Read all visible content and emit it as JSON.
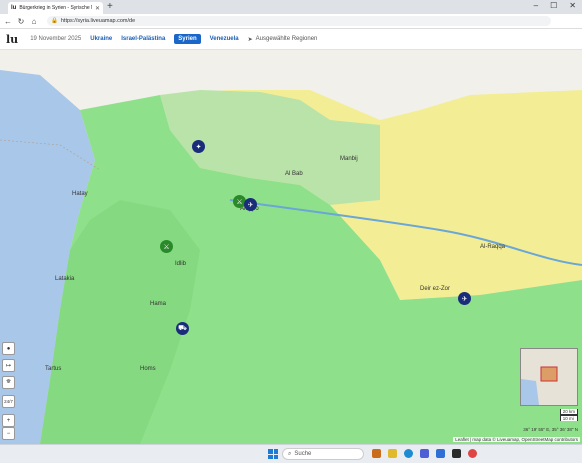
{
  "browser": {
    "tab_title": "Bürgerkrieg in Syrien - Syrische N",
    "url": "https://syria.liveuamap.com/de"
  },
  "site": {
    "logo": "lu",
    "date": "19 November 2025",
    "nav": [
      {
        "label": "Ukraine"
      },
      {
        "label": "Israel-Palästina"
      },
      {
        "label": "Syrien"
      },
      {
        "label": "Venezuela"
      }
    ],
    "regions_label": "Ausgewählte Regionen"
  },
  "map": {
    "scale_km": "20 km",
    "scale_mi": "10 mi",
    "coords": "36° 19' 55\" E, 35° 36' 38\" N",
    "attribution": "Leaflet | map data © Liveuamap, OpenStreetMap contributors",
    "labels": [
      "Hatay",
      "Aleppo",
      "Al Bab",
      "Manbij",
      "Idlib",
      "Al-Raqqa",
      "Hama",
      "Homs",
      "Latakia",
      "Tartus",
      "Deir ez-Zor"
    ],
    "colors": {
      "government": "#8fe08a",
      "sdf": "#f3ee95",
      "turkey": "#b9e3a8",
      "sea": "#a9c7e8",
      "neighbor": "#f2f0ea"
    }
  },
  "controls": [
    "●",
    "↦",
    "⛯",
    "24/7",
    "+",
    "−"
  ],
  "taskbar": {
    "search_placeholder": "Suche"
  }
}
